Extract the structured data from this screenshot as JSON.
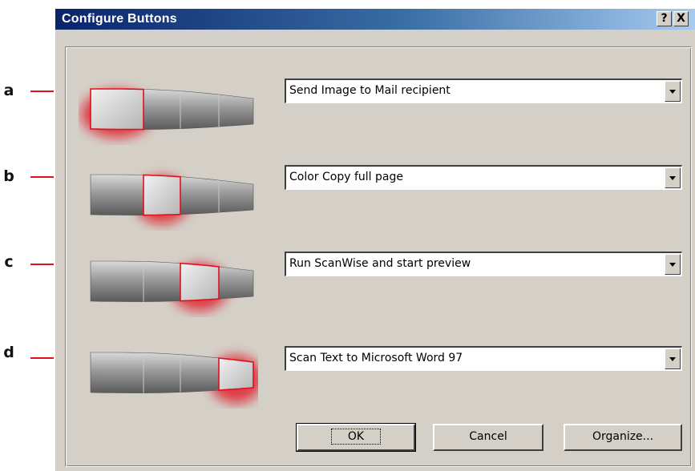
{
  "dialog": {
    "title": "Configure Buttons",
    "help_glyph": "?",
    "close_glyph": "X"
  },
  "callouts": [
    "a",
    "b",
    "c",
    "d"
  ],
  "devices": [
    {
      "highlighted_segment": 1
    },
    {
      "highlighted_segment": 2
    },
    {
      "highlighted_segment": 3
    },
    {
      "highlighted_segment": 4
    }
  ],
  "actions": [
    {
      "value": "Send Image to Mail recipient"
    },
    {
      "value": "Color Copy full page"
    },
    {
      "value": "Run ScanWise and start preview"
    },
    {
      "value": "Scan Text to Microsoft Word 97"
    }
  ],
  "buttons": {
    "ok": "OK",
    "cancel": "Cancel",
    "organize": "Organize..."
  },
  "colors": {
    "highlight": "#e0101e",
    "dialog_face": "#d4d0c8",
    "titlebar_start": "#0a246a"
  },
  "icons": {
    "help": "help-icon",
    "close": "close-icon",
    "dropdown": "chevron-down-icon"
  }
}
